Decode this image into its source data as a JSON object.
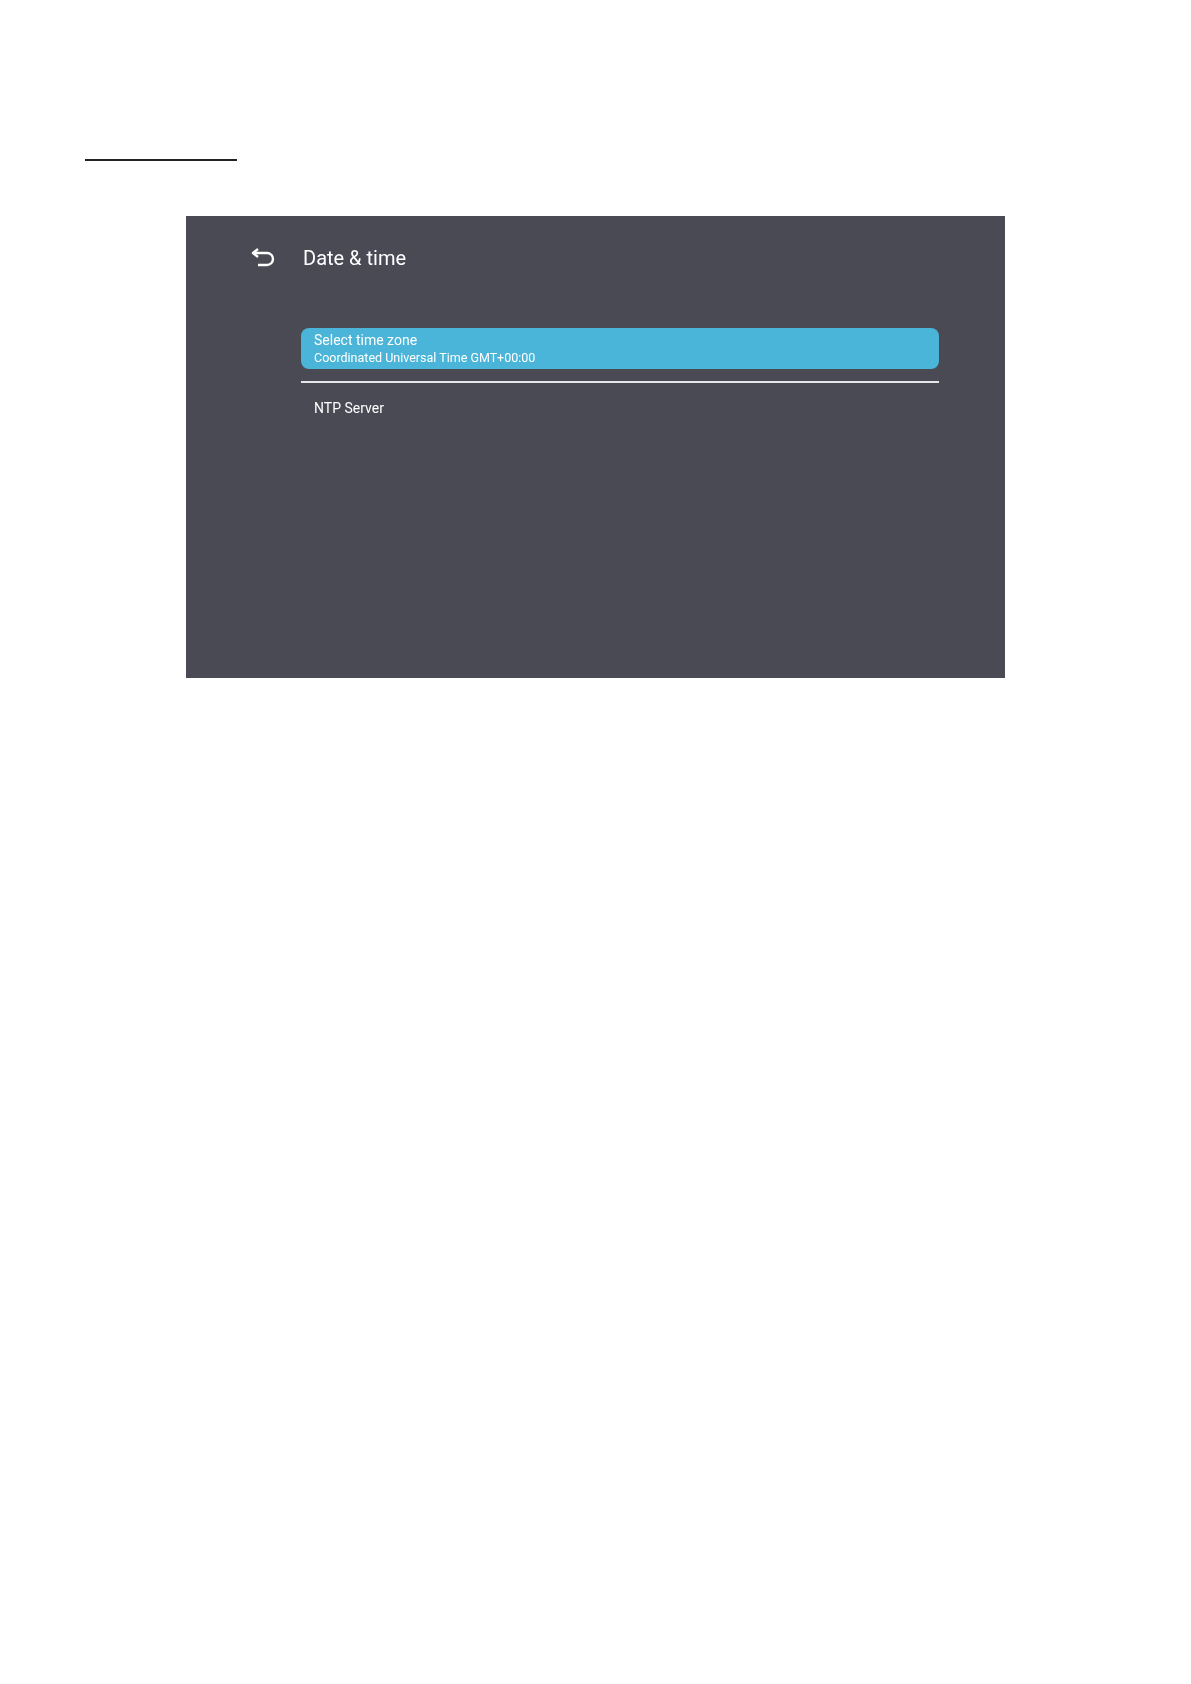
{
  "screen": {
    "title": "Date & time",
    "items": [
      {
        "label": "Select time zone",
        "value": "Coordinated Universal Time GMT+00:00",
        "selected": true
      },
      {
        "label": "NTP Server",
        "selected": false
      }
    ]
  }
}
